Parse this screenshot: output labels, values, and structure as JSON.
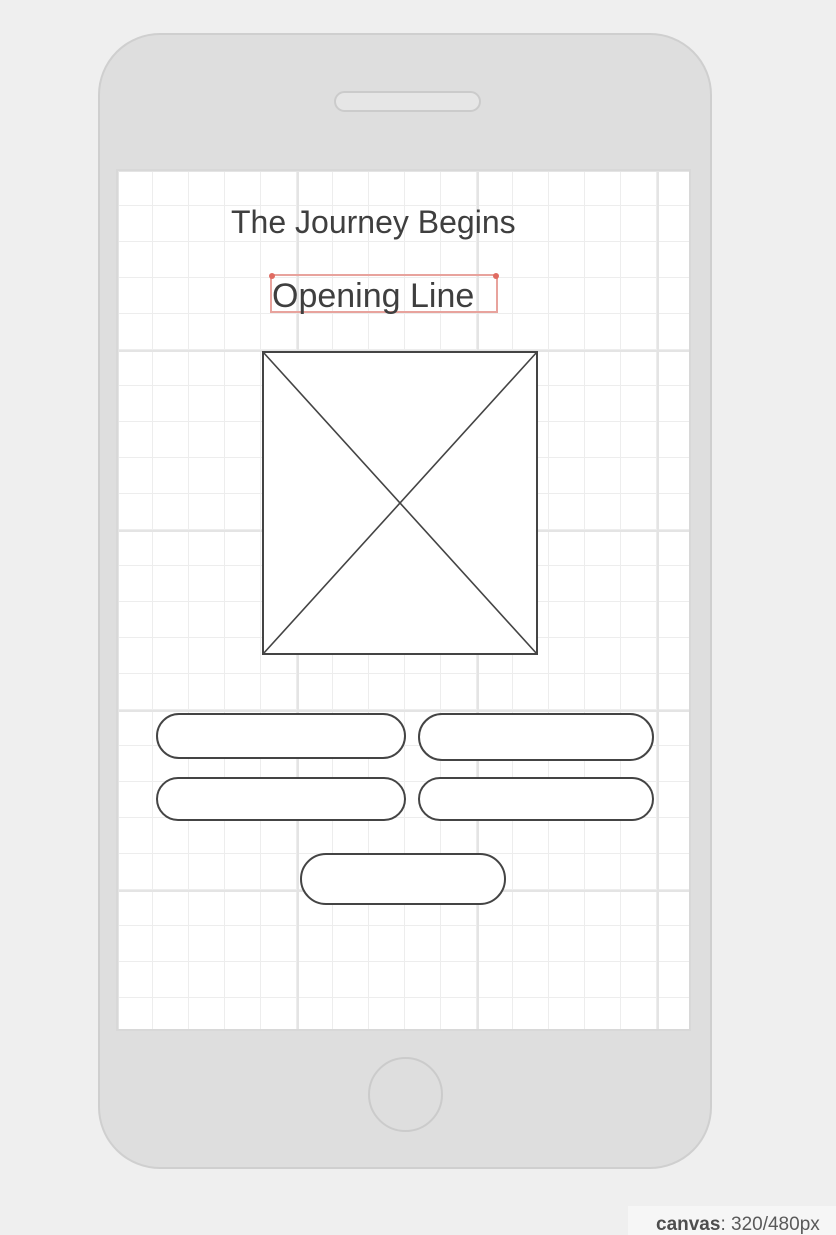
{
  "screen": {
    "title": "The Journey Begins",
    "subtitle": "Opening Line"
  },
  "image": {
    "icon": "image-placeholder-icon"
  },
  "buttons": [
    {
      "label": ""
    },
    {
      "label": ""
    },
    {
      "label": ""
    },
    {
      "label": ""
    },
    {
      "label": ""
    }
  ],
  "footer": {
    "canvas_label": "canvas",
    "canvas_value": ": 320/480px"
  },
  "colors": {
    "selection": "#e06b61",
    "wireframe_stroke": "#444444",
    "device": "#dedede"
  }
}
